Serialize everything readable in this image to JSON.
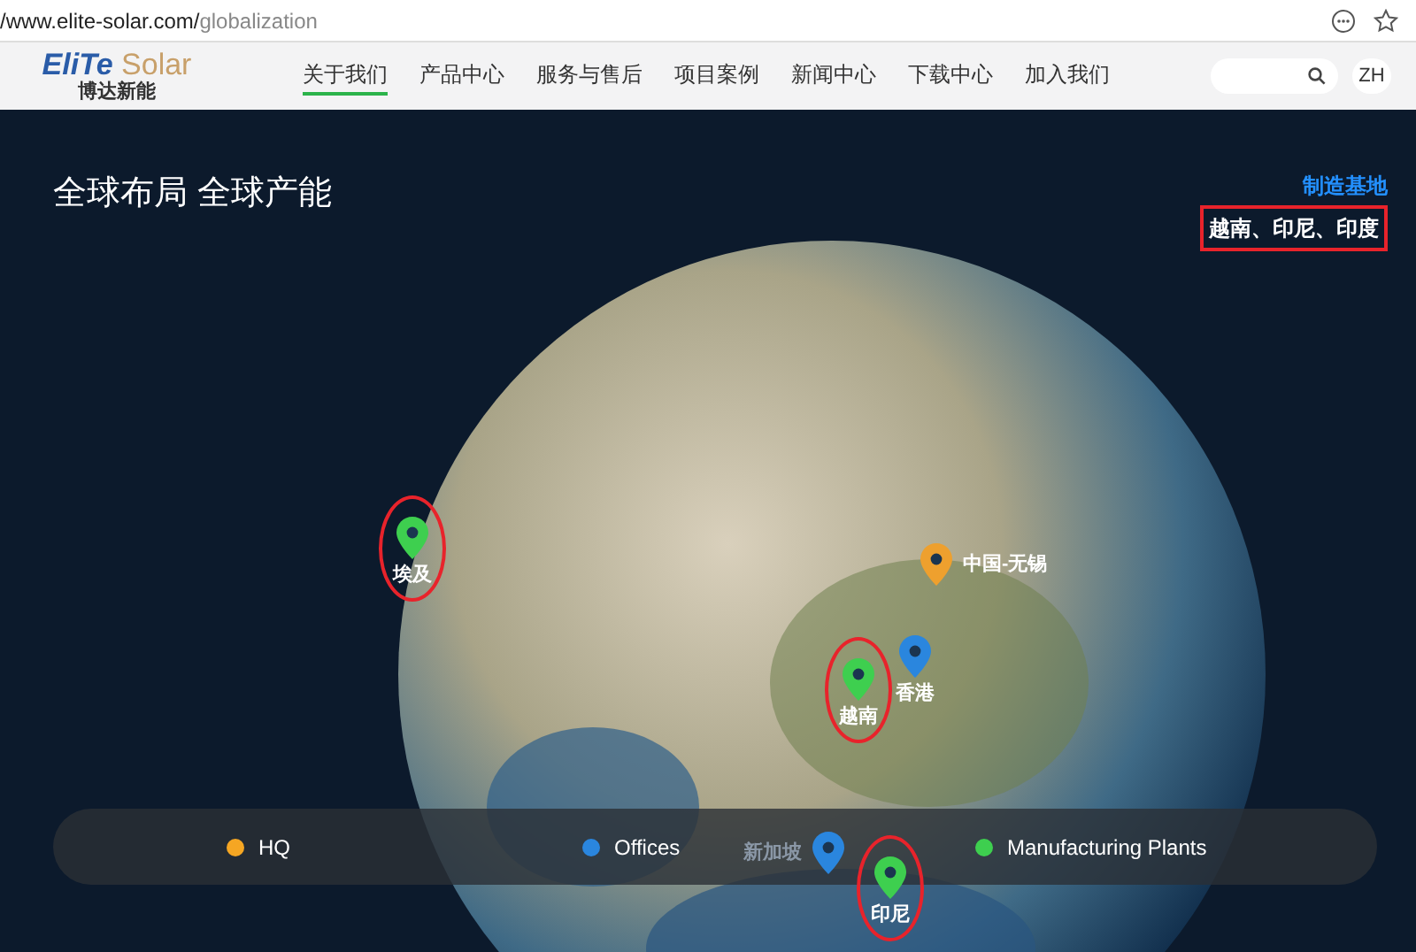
{
  "browser": {
    "url_host": "/www.elite-solar.com/",
    "url_path": "globalization"
  },
  "nav": {
    "logo": {
      "brand_a": "EliTe",
      "brand_b": "Solar",
      "subtitle": "博达新能"
    },
    "items": [
      {
        "label": "关于我们",
        "selected": true
      },
      {
        "label": "产品中心",
        "selected": false
      },
      {
        "label": "服务与售后",
        "selected": false
      },
      {
        "label": "项目案例",
        "selected": false
      },
      {
        "label": "新闻中心",
        "selected": false
      },
      {
        "label": "下载中心",
        "selected": false
      },
      {
        "label": "加入我们",
        "selected": false
      }
    ],
    "language": "ZH"
  },
  "hero": {
    "title": "全球布局 全球产能",
    "side_label": "制造基地",
    "highlight": "越南、印尼、印度",
    "pins": [
      {
        "name": "埃及",
        "color": "#3ecf4f",
        "circled": true,
        "faded": false
      },
      {
        "name": "中国-无锡",
        "color": "#eea02e",
        "circled": false,
        "faded": false
      },
      {
        "name": "香港",
        "color": "#2a86de",
        "circled": false,
        "faded": false
      },
      {
        "name": "越南",
        "color": "#3ecf4f",
        "circled": true,
        "faded": false
      },
      {
        "name": "新加坡",
        "color": "#2a86de",
        "circled": false,
        "faded": true
      },
      {
        "name": "印尼",
        "color": "#3ecf4f",
        "circled": true,
        "faded": false
      }
    ],
    "legend": [
      {
        "label": "HQ",
        "color": "#f5a623"
      },
      {
        "label": "Offices",
        "color": "#2a86de"
      },
      {
        "label": "Manufacturing Plants",
        "color": "#3ecf4f"
      }
    ]
  }
}
